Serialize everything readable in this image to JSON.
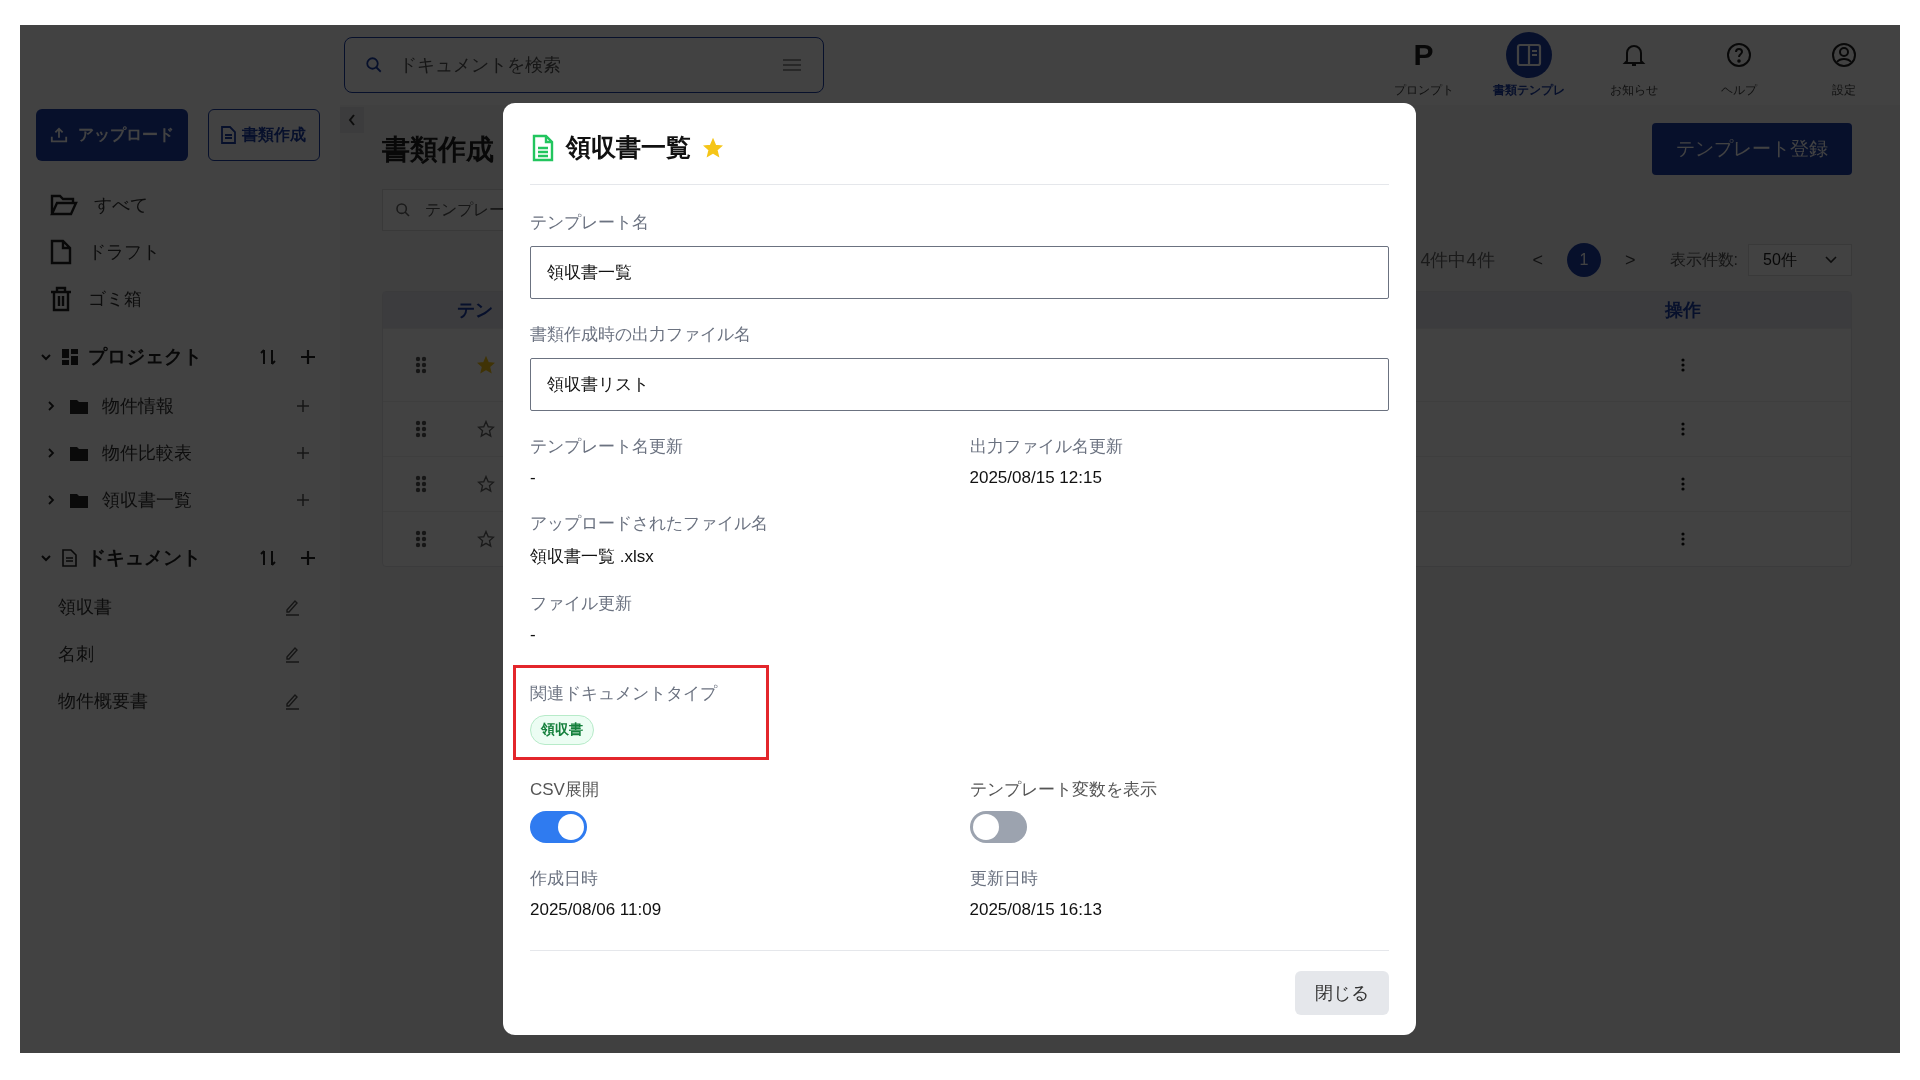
{
  "header": {
    "search": {
      "placeholder": "ドキュメントを検索"
    },
    "nav": [
      {
        "kind": "prompt",
        "glyph": "P",
        "label": "プロンプト",
        "selected": false
      },
      {
        "kind": "template",
        "label": "書類テンプレ",
        "selected": true
      },
      {
        "kind": "bell",
        "label": "お知らせ",
        "selected": false
      },
      {
        "kind": "help",
        "label": "ヘルプ",
        "selected": false
      },
      {
        "kind": "user",
        "label": "設定",
        "selected": false
      }
    ]
  },
  "sidebar": {
    "buttons": [
      {
        "kind": "upload",
        "label": "アップロード"
      },
      {
        "kind": "create",
        "label": "書類作成"
      }
    ],
    "items": [
      {
        "kind": "folder",
        "label": "すべて"
      },
      {
        "kind": "file",
        "label": "ドラフト"
      },
      {
        "kind": "trash",
        "label": "ゴミ箱"
      }
    ],
    "sections": [
      {
        "kind": "project",
        "title": "プロジェクト",
        "expanded": true,
        "children": [
          {
            "label": "物件情報",
            "expanded": false
          },
          {
            "label": "物件比較表",
            "expanded": false
          },
          {
            "label": "領収書一覧",
            "expanded": false
          }
        ]
      },
      {
        "kind": "document",
        "title": "ドキュメント",
        "expanded": true,
        "children": [
          {
            "label": "領収書"
          },
          {
            "label": "名刺"
          },
          {
            "label": "物件概要書"
          }
        ]
      }
    ]
  },
  "main": {
    "title": "書類作成",
    "search": {
      "placeholder": "テンプレー"
    },
    "register_button": "テンプレート登録",
    "pagination": {
      "summary": "4件中4件",
      "prev": "<",
      "pages": [
        {
          "label": "1",
          "selected": true
        }
      ],
      "next": ">",
      "page_size_label": "表示件数:",
      "page_size": "50件"
    },
    "table": {
      "columns": [
        "テン",
        "操作"
      ],
      "rows": [
        {
          "favorite": true
        },
        {
          "favorite": false
        },
        {
          "favorite": false
        },
        {
          "favorite": false
        }
      ]
    }
  },
  "modal": {
    "title": "領収書一覧",
    "favorite": true,
    "fields": [
      {
        "label": "テンプレート名",
        "value": "領収書一覧"
      },
      {
        "label": "書類作成時の出力ファイル名",
        "value": "領収書リスト"
      }
    ],
    "rows": [
      [
        {
          "kind": "text",
          "label": "テンプレート名更新",
          "value": "-"
        },
        {
          "kind": "text",
          "label": "出力ファイル名更新",
          "value": "2025/08/15 12:15"
        }
      ],
      [
        {
          "kind": "text",
          "label": "アップロードされたファイル名",
          "value": "領収書一覧 .xlsx"
        }
      ],
      [
        {
          "kind": "text",
          "label": "ファイル更新",
          "value": "-"
        }
      ],
      [
        {
          "kind": "tags",
          "label": "関連ドキュメントタイプ",
          "highlighted": true,
          "tags": [
            "領収書"
          ]
        }
      ],
      [
        {
          "kind": "toggle",
          "label": "CSV展開",
          "on": true
        },
        {
          "kind": "toggle",
          "label": "テンプレート変数を表示",
          "on": false
        }
      ],
      [
        {
          "kind": "text",
          "label": "作成日時",
          "value": "2025/08/06 11:09"
        },
        {
          "kind": "text",
          "label": "更新日時",
          "value": "2025/08/15 16:13"
        }
      ]
    ],
    "close_button": "閉じる"
  }
}
